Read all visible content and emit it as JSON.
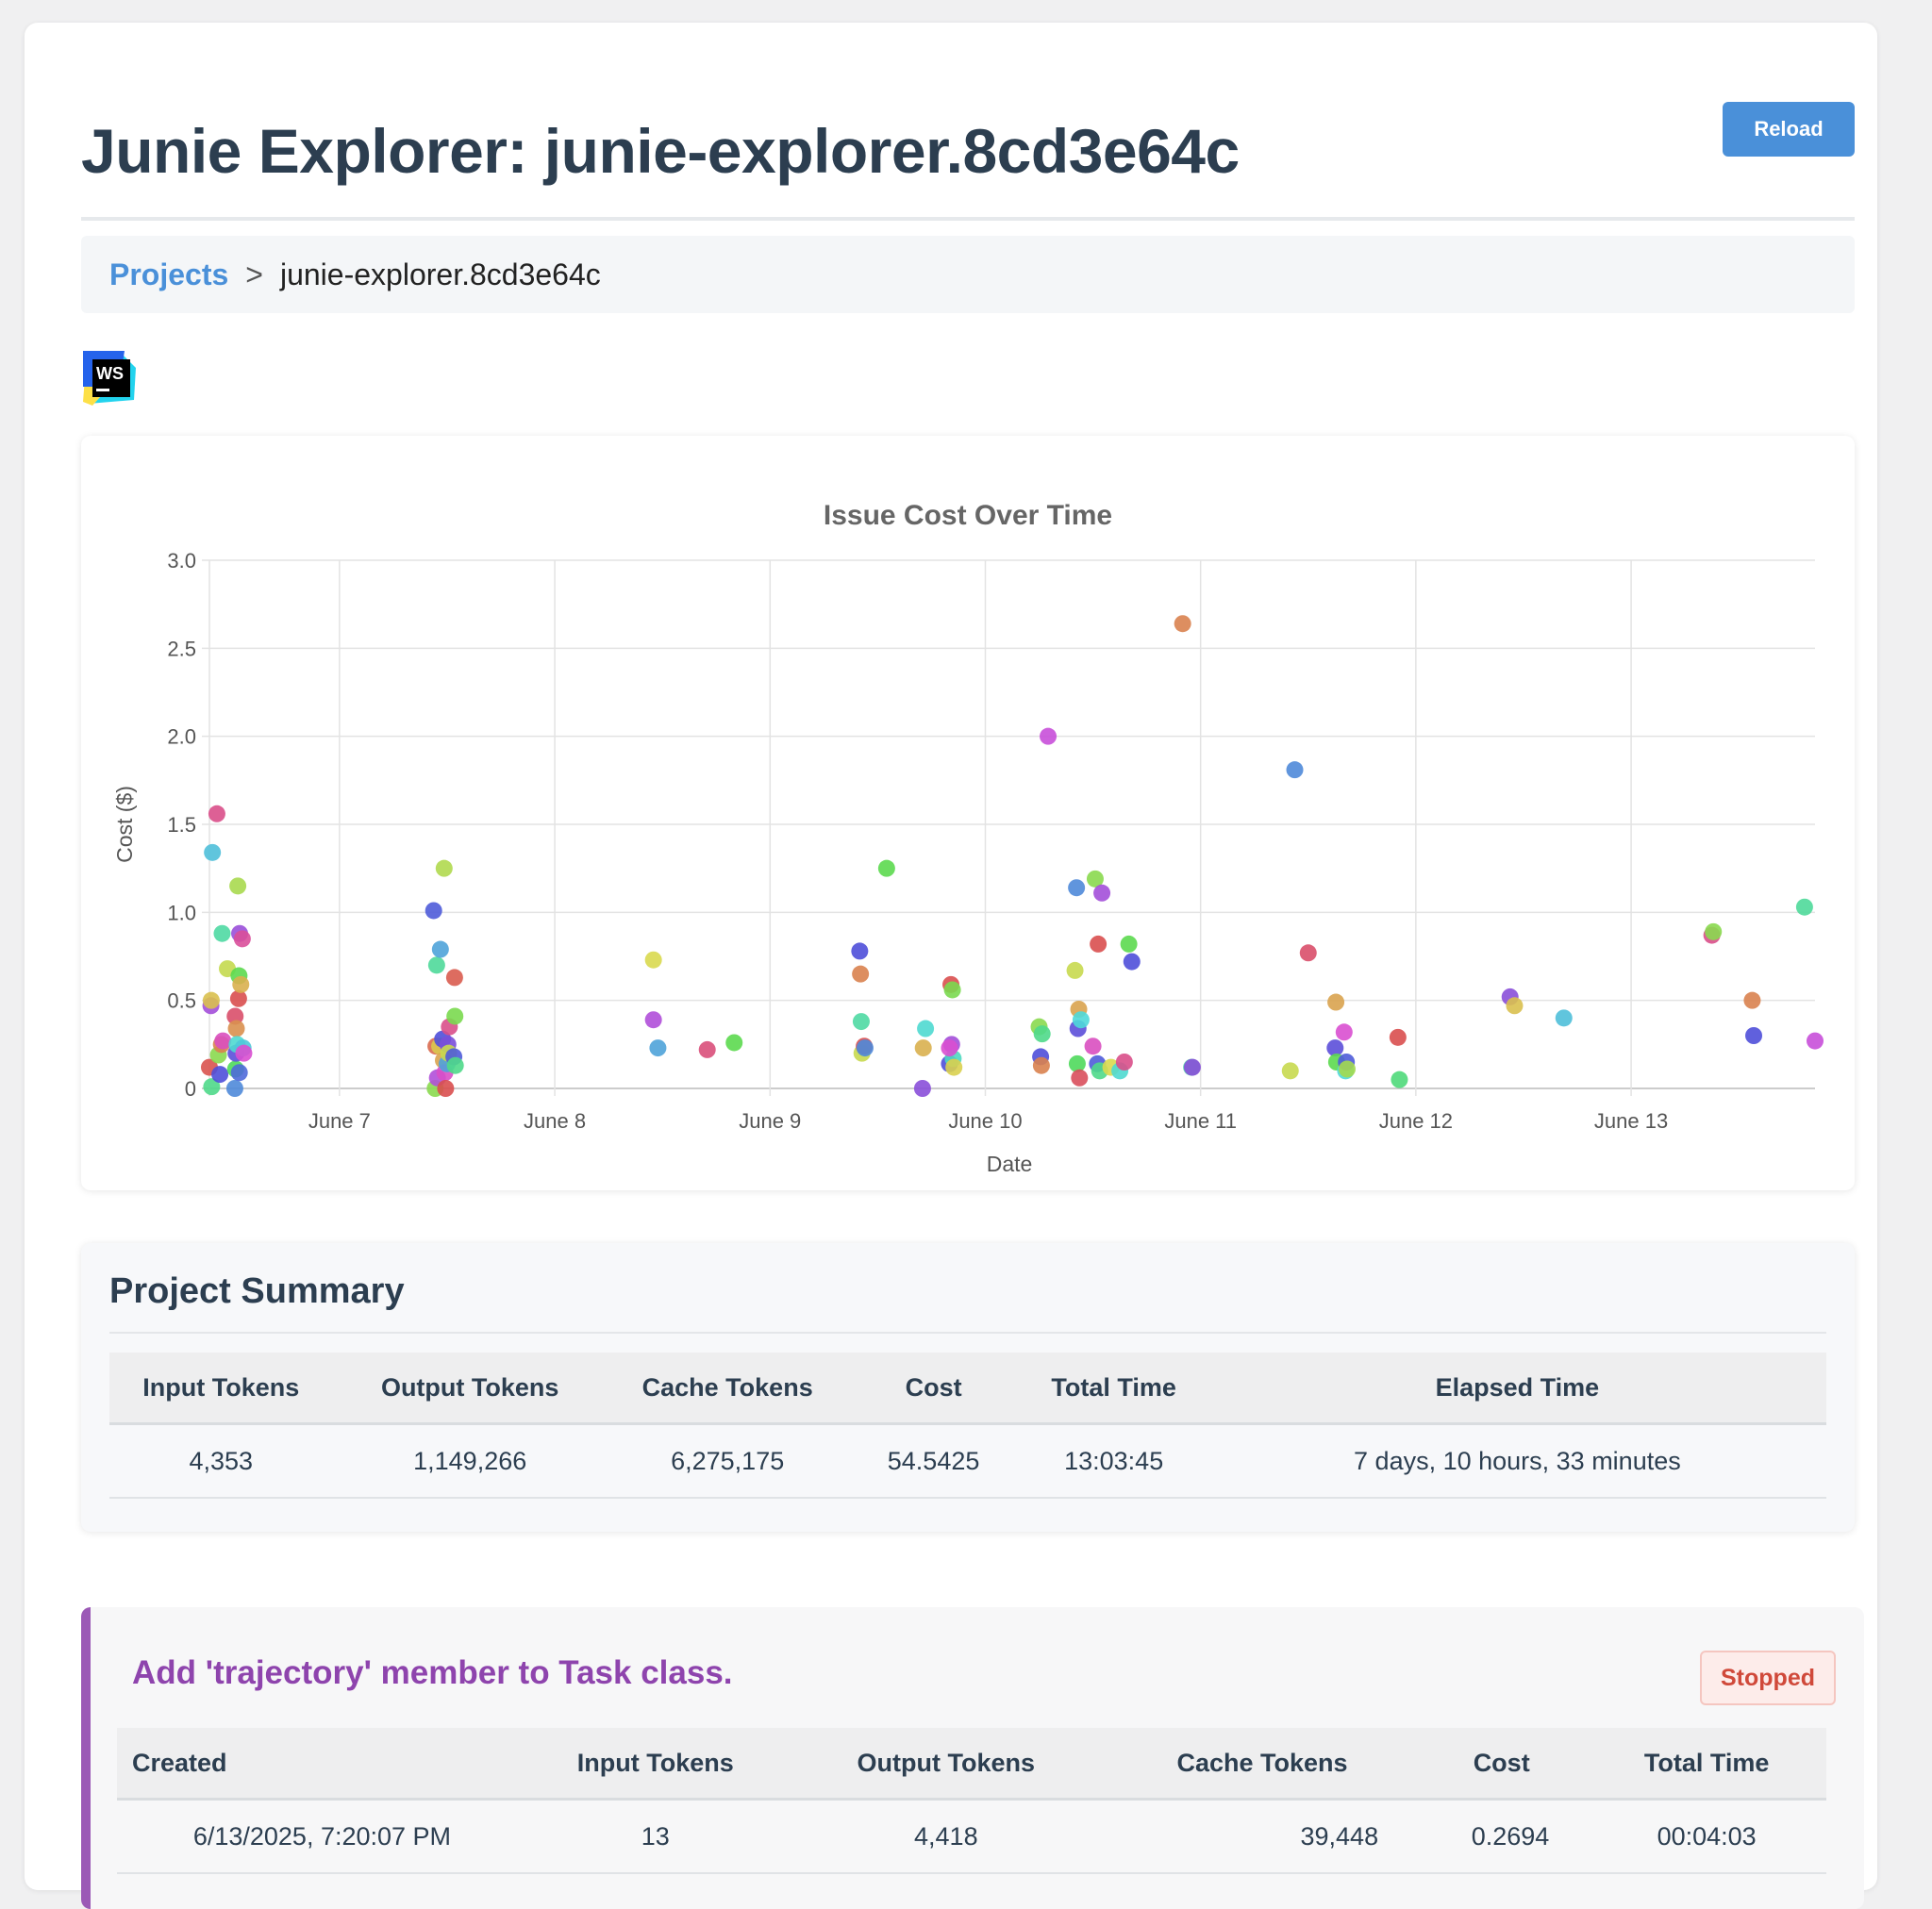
{
  "header": {
    "title": "Junie Explorer: junie-explorer.8cd3e64c",
    "reload_label": "Reload"
  },
  "breadcrumb": {
    "root_label": "Projects",
    "separator": ">",
    "current": "junie-explorer.8cd3e64c"
  },
  "logo": {
    "text": "WS",
    "icon": "webstorm-logo-icon"
  },
  "chart_data": {
    "type": "scatter",
    "title": "Issue Cost Over Time",
    "xlabel": "Date",
    "ylabel": "Cost ($)",
    "x_ticks": [
      "June 7",
      "June 8",
      "June 9",
      "June 10",
      "June 11",
      "June 12",
      "June 13"
    ],
    "y_ticks": [
      "0",
      "0.5",
      "1.0",
      "1.5",
      "2.0",
      "2.5",
      "3.0"
    ],
    "ylim": [
      0,
      3.0
    ],
    "xlim": [
      "2025-06-06T09:30",
      "2025-06-13T20:30"
    ],
    "grid": true,
    "legend": "none",
    "points": [
      {
        "x": "2025-06-06T09:30",
        "y": 0.12,
        "color": "#d9534f"
      },
      {
        "x": "2025-06-06T09:40",
        "y": 0.47,
        "color": "#a34fd9"
      },
      {
        "x": "2025-06-06T09:42",
        "y": 0.5,
        "color": "#d9c04f"
      },
      {
        "x": "2025-06-06T09:45",
        "y": 0.01,
        "color": "#4fd98a"
      },
      {
        "x": "2025-06-06T09:50",
        "y": 1.34,
        "color": "#4fbfd9"
      },
      {
        "x": "2025-06-06T10:20",
        "y": 1.56,
        "color": "#d94f8a"
      },
      {
        "x": "2025-06-06T10:30",
        "y": 0.19,
        "color": "#8ad94f"
      },
      {
        "x": "2025-06-06T10:40",
        "y": 0.08,
        "color": "#4f4fd9"
      },
      {
        "x": "2025-06-06T10:50",
        "y": 0.25,
        "color": "#d9824f"
      },
      {
        "x": "2025-06-06T10:55",
        "y": 0.88,
        "color": "#4fd9a3"
      },
      {
        "x": "2025-06-06T11:00",
        "y": 0.27,
        "color": "#d94fbf"
      },
      {
        "x": "2025-06-06T11:30",
        "y": 0.68,
        "color": "#c4d94f"
      },
      {
        "x": "2025-06-06T12:20",
        "y": 0.0,
        "color": "#4f8ad9"
      },
      {
        "x": "2025-06-06T12:22",
        "y": 0.41,
        "color": "#d94f6a"
      },
      {
        "x": "2025-06-06T12:25",
        "y": 0.11,
        "color": "#4fd95c"
      },
      {
        "x": "2025-06-06T12:28",
        "y": 0.2,
        "color": "#5c4fd9"
      },
      {
        "x": "2025-06-06T12:30",
        "y": 0.34,
        "color": "#d9904f"
      },
      {
        "x": "2025-06-06T12:35",
        "y": 0.25,
        "color": "#4fd9d0"
      },
      {
        "x": "2025-06-06T12:40",
        "y": 1.15,
        "color": "#a9d94f"
      },
      {
        "x": "2025-06-06T12:45",
        "y": 0.51,
        "color": "#d94f4f"
      },
      {
        "x": "2025-06-06T12:48",
        "y": 0.64,
        "color": "#5cd94f"
      },
      {
        "x": "2025-06-06T12:50",
        "y": 0.09,
        "color": "#4f6ad9"
      },
      {
        "x": "2025-06-06T12:52",
        "y": 0.88,
        "color": "#9a4fd9"
      },
      {
        "x": "2025-06-06T13:00",
        "y": 0.59,
        "color": "#d9b04f"
      },
      {
        "x": "2025-06-06T13:10",
        "y": 0.85,
        "color": "#d94f9a"
      },
      {
        "x": "2025-06-06T13:15",
        "y": 0.23,
        "color": "#4fc8d9"
      },
      {
        "x": "2025-06-06T13:20",
        "y": 0.2,
        "color": "#d94fd0"
      },
      {
        "x": "2025-06-07T10:30",
        "y": 1.01,
        "color": "#4f5cd9"
      },
      {
        "x": "2025-06-07T10:40",
        "y": 0.0,
        "color": "#8ad94f"
      },
      {
        "x": "2025-06-07T10:45",
        "y": 0.24,
        "color": "#d96a4f"
      },
      {
        "x": "2025-06-07T10:50",
        "y": 0.7,
        "color": "#4fd99a"
      },
      {
        "x": "2025-06-07T10:55",
        "y": 0.06,
        "color": "#b04fd9"
      },
      {
        "x": "2025-06-07T11:10",
        "y": 0.24,
        "color": "#d9c84f"
      },
      {
        "x": "2025-06-07T11:15",
        "y": 0.79,
        "color": "#4fa3d9"
      },
      {
        "x": "2025-06-07T11:30",
        "y": 0.28,
        "color": "#4f4fd9"
      },
      {
        "x": "2025-06-07T11:35",
        "y": 0.16,
        "color": "#d9a34f"
      },
      {
        "x": "2025-06-07T11:40",
        "y": 1.25,
        "color": "#b0d94f"
      },
      {
        "x": "2025-06-07T11:45",
        "y": 0.09,
        "color": "#d94fc8"
      },
      {
        "x": "2025-06-07T11:50",
        "y": 0.0,
        "color": "#d94f4f"
      },
      {
        "x": "2025-06-07T12:00",
        "y": 0.14,
        "color": "#4fa3d9"
      },
      {
        "x": "2025-06-07T12:05",
        "y": 0.25,
        "color": "#7a4fd9"
      },
      {
        "x": "2025-06-07T12:10",
        "y": 0.2,
        "color": "#c8d94f"
      },
      {
        "x": "2025-06-07T12:15",
        "y": 0.35,
        "color": "#d94f8a"
      },
      {
        "x": "2025-06-07T12:45",
        "y": 0.18,
        "color": "#4f5cd9"
      },
      {
        "x": "2025-06-07T12:50",
        "y": 0.63,
        "color": "#d95c4f"
      },
      {
        "x": "2025-06-07T12:52",
        "y": 0.41,
        "color": "#7ad94f"
      },
      {
        "x": "2025-06-07T12:55",
        "y": 0.13,
        "color": "#4fd98a"
      },
      {
        "x": "2025-06-08T11:00",
        "y": 0.73,
        "color": "#d9d94f"
      },
      {
        "x": "2025-06-08T11:00",
        "y": 0.39,
        "color": "#b04fd9"
      },
      {
        "x": "2025-06-08T11:30",
        "y": 0.23,
        "color": "#4fa3d9"
      },
      {
        "x": "2025-06-08T17:00",
        "y": 0.22,
        "color": "#d94f7a"
      },
      {
        "x": "2025-06-08T20:00",
        "y": 0.26,
        "color": "#5cd94f"
      },
      {
        "x": "2025-06-09T10:00",
        "y": 0.78,
        "color": "#4f4fd9"
      },
      {
        "x": "2025-06-09T10:05",
        "y": 0.65,
        "color": "#d9824f"
      },
      {
        "x": "2025-06-09T10:10",
        "y": 0.38,
        "color": "#4fd9a3"
      },
      {
        "x": "2025-06-09T10:15",
        "y": 0.2,
        "color": "#c8d94f"
      },
      {
        "x": "2025-06-09T10:30",
        "y": 0.24,
        "color": "#d94f4f"
      },
      {
        "x": "2025-06-09T10:35",
        "y": 0.23,
        "color": "#4f8ad9"
      },
      {
        "x": "2025-06-09T13:00",
        "y": 1.25,
        "color": "#5cd94f"
      },
      {
        "x": "2025-06-09T17:00",
        "y": 0.0,
        "color": "#8a4fd9"
      },
      {
        "x": "2025-06-09T17:05",
        "y": 0.23,
        "color": "#d9b04f"
      },
      {
        "x": "2025-06-09T17:20",
        "y": 0.34,
        "color": "#4fd9d0"
      },
      {
        "x": "2025-06-09T20:00",
        "y": 0.14,
        "color": "#4f4fd9"
      },
      {
        "x": "2025-06-09T20:10",
        "y": 0.59,
        "color": "#d94f4f"
      },
      {
        "x": "2025-06-09T20:15",
        "y": 0.25,
        "color": "#a34fd9"
      },
      {
        "x": "2025-06-09T20:20",
        "y": 0.56,
        "color": "#7ad94f"
      },
      {
        "x": "2025-06-09T20:25",
        "y": 0.17,
        "color": "#4fd9c0"
      },
      {
        "x": "2025-06-09T20:30",
        "y": 0.12,
        "color": "#d9d04f"
      },
      {
        "x": "2025-06-09T20:00",
        "y": 0.23,
        "color": "#d94fd0"
      },
      {
        "x": "2025-06-10T06:00",
        "y": 0.35,
        "color": "#8ad94f"
      },
      {
        "x": "2025-06-10T06:10",
        "y": 0.18,
        "color": "#4f4fd9"
      },
      {
        "x": "2025-06-10T06:15",
        "y": 0.13,
        "color": "#d9824f"
      },
      {
        "x": "2025-06-10T06:20",
        "y": 0.31,
        "color": "#4fd98a"
      },
      {
        "x": "2025-06-10T07:00",
        "y": 2.0,
        "color": "#c84fd9"
      },
      {
        "x": "2025-06-10T10:00",
        "y": 0.67,
        "color": "#c8d94f"
      },
      {
        "x": "2025-06-10T10:10",
        "y": 1.14,
        "color": "#4f8ad9"
      },
      {
        "x": "2025-06-10T10:15",
        "y": 0.14,
        "color": "#4fd95c"
      },
      {
        "x": "2025-06-10T10:20",
        "y": 0.34,
        "color": "#5c4fd9"
      },
      {
        "x": "2025-06-10T10:25",
        "y": 0.45,
        "color": "#d9a34f"
      },
      {
        "x": "2025-06-10T10:30",
        "y": 0.06,
        "color": "#d94f5c"
      },
      {
        "x": "2025-06-10T10:40",
        "y": 0.39,
        "color": "#4fd9d9"
      },
      {
        "x": "2025-06-10T12:00",
        "y": 0.24,
        "color": "#d94fc0"
      },
      {
        "x": "2025-06-10T12:15",
        "y": 1.19,
        "color": "#8ad94f"
      },
      {
        "x": "2025-06-10T12:30",
        "y": 0.14,
        "color": "#4f5cd9"
      },
      {
        "x": "2025-06-10T12:35",
        "y": 0.82,
        "color": "#d94f4f"
      },
      {
        "x": "2025-06-10T12:45",
        "y": 0.1,
        "color": "#4fd98a"
      },
      {
        "x": "2025-06-10T13:00",
        "y": 1.11,
        "color": "#a34fd9"
      },
      {
        "x": "2025-06-10T14:00",
        "y": 0.12,
        "color": "#d9d94f"
      },
      {
        "x": "2025-06-10T15:00",
        "y": 0.1,
        "color": "#4fd9d0"
      },
      {
        "x": "2025-06-10T15:30",
        "y": 0.15,
        "color": "#d94f8a"
      },
      {
        "x": "2025-06-10T16:00",
        "y": 0.82,
        "color": "#5cd94f"
      },
      {
        "x": "2025-06-10T16:20",
        "y": 0.72,
        "color": "#4f4fd9"
      },
      {
        "x": "2025-06-10T22:00",
        "y": 2.64,
        "color": "#d9824f"
      },
      {
        "x": "2025-06-10T23:00",
        "y": 0.12,
        "color": "#4fd9a3"
      },
      {
        "x": "2025-06-10T23:05",
        "y": 0.12,
        "color": "#8a4fd9"
      },
      {
        "x": "2025-06-11T10:00",
        "y": 0.1,
        "color": "#c8d94f"
      },
      {
        "x": "2025-06-11T10:30",
        "y": 1.81,
        "color": "#4f8ad9"
      },
      {
        "x": "2025-06-11T12:00",
        "y": 0.77,
        "color": "#d94f6a"
      },
      {
        "x": "2025-06-11T15:00",
        "y": 0.23,
        "color": "#5c4fd9"
      },
      {
        "x": "2025-06-11T15:05",
        "y": 0.49,
        "color": "#d9a34f"
      },
      {
        "x": "2025-06-11T15:10",
        "y": 0.15,
        "color": "#5cd94f"
      },
      {
        "x": "2025-06-11T16:00",
        "y": 0.32,
        "color": "#d94fd0"
      },
      {
        "x": "2025-06-11T16:10",
        "y": 0.1,
        "color": "#4fd9d9"
      },
      {
        "x": "2025-06-11T16:15",
        "y": 0.15,
        "color": "#4f5cd9"
      },
      {
        "x": "2025-06-11T16:20",
        "y": 0.11,
        "color": "#a3d94f"
      },
      {
        "x": "2025-06-11T22:00",
        "y": 0.29,
        "color": "#d94f4f"
      },
      {
        "x": "2025-06-11T22:10",
        "y": 0.05,
        "color": "#4fd97a"
      },
      {
        "x": "2025-06-12T10:30",
        "y": 0.52,
        "color": "#8a4fd9"
      },
      {
        "x": "2025-06-12T11:00",
        "y": 0.47,
        "color": "#d9c04f"
      },
      {
        "x": "2025-06-12T16:30",
        "y": 0.4,
        "color": "#4fbfd9"
      },
      {
        "x": "2025-06-13T09:00",
        "y": 0.87,
        "color": "#d94f8a"
      },
      {
        "x": "2025-06-13T09:10",
        "y": 0.89,
        "color": "#8ad94f"
      },
      {
        "x": "2025-06-13T13:30",
        "y": 0.5,
        "color": "#d9824f"
      },
      {
        "x": "2025-06-13T13:40",
        "y": 0.3,
        "color": "#4f4fd9"
      },
      {
        "x": "2025-06-13T19:20",
        "y": 1.03,
        "color": "#4fd99a"
      },
      {
        "x": "2025-06-13T20:30",
        "y": 0.27,
        "color": "#c84fd9"
      }
    ]
  },
  "summary": {
    "title": "Project Summary",
    "headers": [
      "Input Tokens",
      "Output Tokens",
      "Cache Tokens",
      "Cost",
      "Total Time",
      "Elapsed Time"
    ],
    "values": [
      "4,353",
      "1,149,266",
      "6,275,175",
      "54.5425",
      "13:03:45",
      "7 days, 10 hours, 33 minutes"
    ]
  },
  "task": {
    "title": "Add 'trajectory' member to Task class.",
    "status": "Stopped",
    "accent_color": "#9b59b6",
    "headers": [
      "Created",
      "Input Tokens",
      "Output Tokens",
      "Cache Tokens",
      "Cost",
      "Total Time"
    ],
    "values": [
      "6/13/2025, 7:20:07 PM",
      "13",
      "4,418",
      "39,448",
      "0.2694",
      "00:04:03"
    ]
  }
}
